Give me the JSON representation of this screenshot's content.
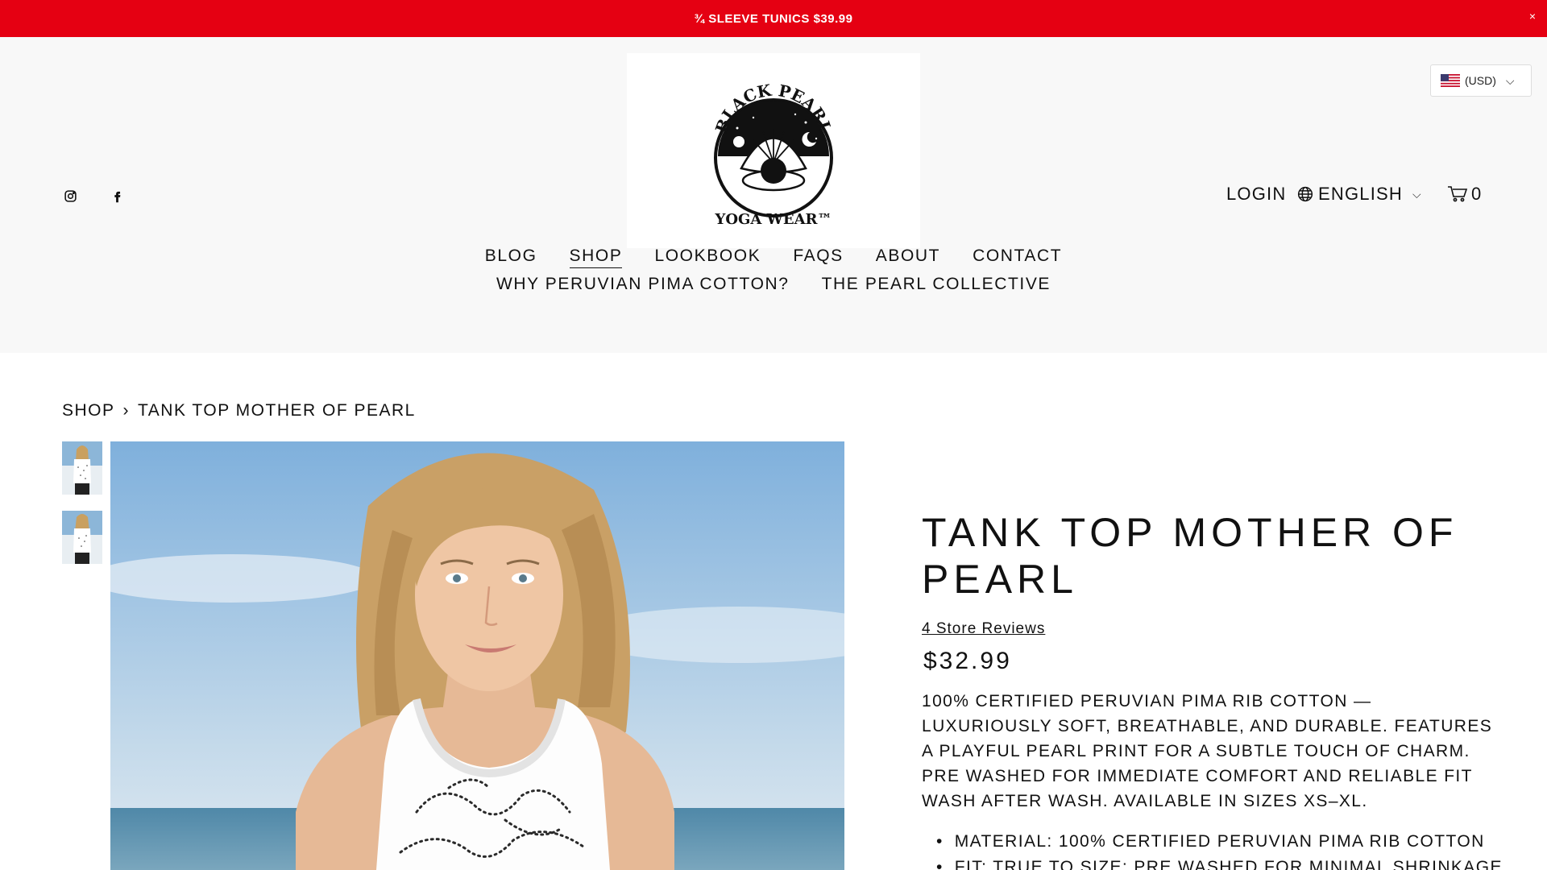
{
  "announcement": {
    "text": "¾ SLEEVE TUNICS $39.99",
    "close": "×"
  },
  "header": {
    "social": [
      "instagram-icon",
      "facebook-icon"
    ],
    "logo": {
      "text_top": "BLACK PEARL",
      "text_bottom": "YOGA WEAR™"
    },
    "currency": {
      "label": "(USD)",
      "flag": "us-flag-icon"
    },
    "login": "LOGIN",
    "language": "ENGLISH",
    "cart_count": "0"
  },
  "nav": {
    "row1": [
      "BLOG",
      "SHOP",
      "LOOKBOOK",
      "FAQS",
      "ABOUT",
      "CONTACT"
    ],
    "row2": [
      "WHY PERUVIAN PIMA COTTON?",
      "THE PEARL COLLECTIVE"
    ],
    "active": "SHOP"
  },
  "breadcrumb": {
    "parent": "SHOP",
    "separator": "›",
    "current": "TANK TOP MOTHER OF PEARL"
  },
  "product": {
    "title": "TANK TOP MOTHER OF PEARL",
    "reviews": "4 Store Reviews",
    "price": "$32.99",
    "description": "100% CERTIFIED PERUVIAN PIMA RIB COTTON — LUXURIOUSLY SOFT, BREATHABLE, AND DURABLE. FEATURES A PLAYFUL PEARL PRINT FOR A SUBTLE TOUCH OF CHARM. PRE WASHED FOR IMMEDIATE COMFORT AND RELIABLE FIT WASH AFTER WASH. AVAILABLE IN SIZES XS–XL.",
    "bullets": [
      "MATERIAL: 100% CERTIFIED PERUVIAN PIMA RIB COTTON",
      "FIT: TRUE TO SIZE; PRE WASHED FOR MINIMAL SHRINKAGE"
    ]
  },
  "colors": {
    "announce_bg": "#e50012",
    "header_bg": "#f8f8f8"
  }
}
